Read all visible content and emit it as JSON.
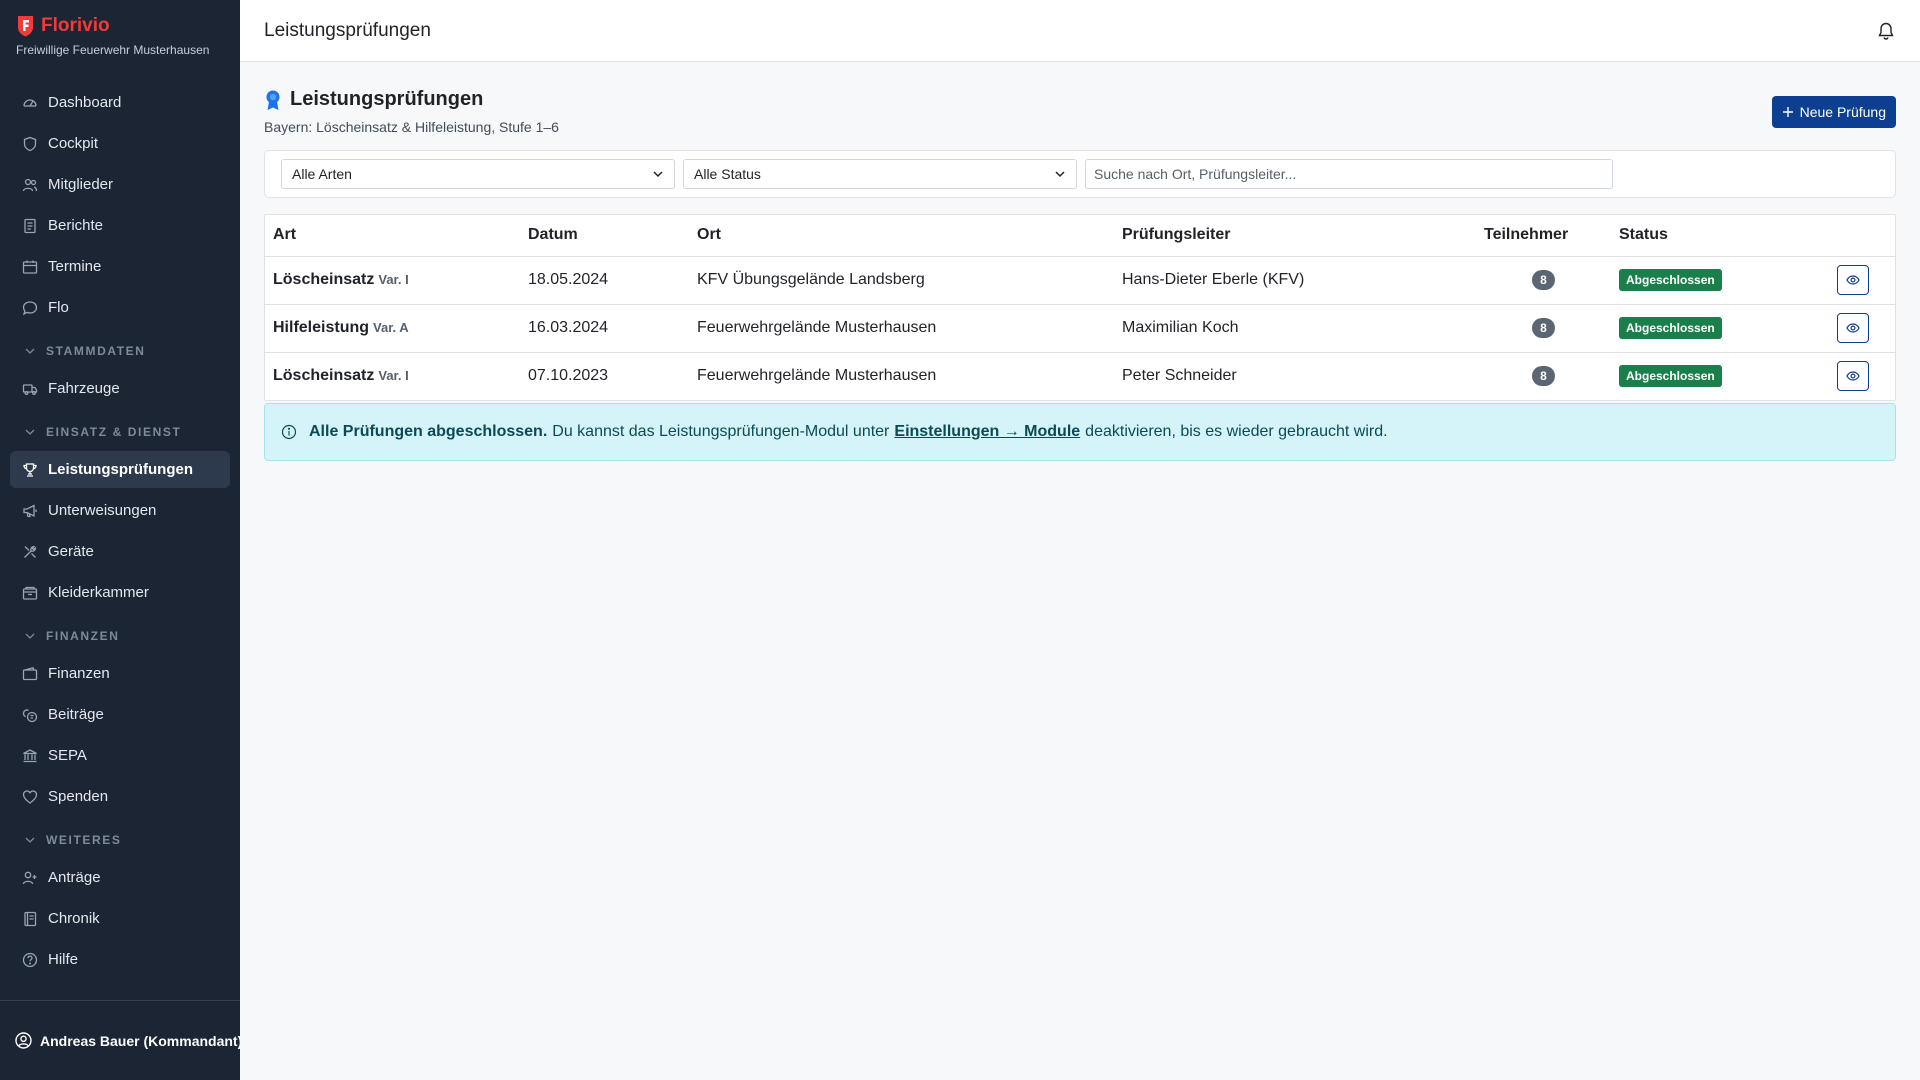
{
  "brand": {
    "name": "Florivio",
    "org": "Freiwillige Feuerwehr Musterhausen"
  },
  "sidebar": {
    "items_top": [
      {
        "label": "Dashboard",
        "icon": "gauge-icon"
      },
      {
        "label": "Cockpit",
        "icon": "shield-icon"
      },
      {
        "label": "Mitglieder",
        "icon": "users-icon"
      },
      {
        "label": "Berichte",
        "icon": "document-icon"
      },
      {
        "label": "Termine",
        "icon": "calendar-icon"
      },
      {
        "label": "Flo",
        "icon": "chat-icon"
      }
    ],
    "sec_stammdaten": "STAMMDATEN",
    "items_stammdaten": [
      {
        "label": "Fahrzeuge",
        "icon": "truck-icon"
      }
    ],
    "sec_einsatz": "EINSATZ & DIENST",
    "items_einsatz": [
      {
        "label": "Leistungsprüfungen",
        "icon": "trophy-icon",
        "active": true
      },
      {
        "label": "Unterweisungen",
        "icon": "megaphone-icon"
      },
      {
        "label": "Geräte",
        "icon": "tools-icon"
      },
      {
        "label": "Kleiderkammer",
        "icon": "box-icon"
      }
    ],
    "sec_finanzen": "FINANZEN",
    "items_finanzen": [
      {
        "label": "Finanzen",
        "icon": "wallet-icon"
      },
      {
        "label": "Beiträge",
        "icon": "coins-icon"
      },
      {
        "label": "SEPA",
        "icon": "bank-icon"
      },
      {
        "label": "Spenden",
        "icon": "heart-icon"
      }
    ],
    "sec_weiteres": "WEITERES",
    "items_weiteres": [
      {
        "label": "Anträge",
        "icon": "user-plus-icon"
      },
      {
        "label": "Chronik",
        "icon": "journal-icon"
      },
      {
        "label": "Hilfe",
        "icon": "question-icon"
      }
    ],
    "user": "Andreas Bauer (Kommandant)"
  },
  "topbar": {
    "title": "Leistungsprüfungen"
  },
  "page": {
    "title": "Leistungsprüfungen",
    "subtitle": "Bayern: Löscheinsatz & Hilfeleistung, Stufe 1–6",
    "new_button": "Neue Prüfung"
  },
  "filters": {
    "art": "Alle Arten",
    "status": "Alle Status",
    "search_placeholder": "Suche nach Ort, Prüfungsleiter..."
  },
  "table": {
    "headers": {
      "art": "Art",
      "datum": "Datum",
      "ort": "Ort",
      "leiter": "Prüfungsleiter",
      "teilnehmer": "Teilnehmer",
      "status": "Status"
    },
    "rows": [
      {
        "art": "Löscheinsatz",
        "var": "Var. I",
        "datum": "18.05.2024",
        "ort": "KFV Übungsgelände Landsberg",
        "leiter": "Hans-Dieter Eberle (KFV)",
        "teilnehmer": "8",
        "status": "Abgeschlossen"
      },
      {
        "art": "Hilfeleistung",
        "var": "Var. A",
        "datum": "16.03.2024",
        "ort": "Feuerwehrgelände Musterhausen",
        "leiter": "Maximilian Koch",
        "teilnehmer": "8",
        "status": "Abgeschlossen"
      },
      {
        "art": "Löscheinsatz",
        "var": "Var. I",
        "datum": "07.10.2023",
        "ort": "Feuerwehrgelände Musterhausen",
        "leiter": "Peter Schneider",
        "teilnehmer": "8",
        "status": "Abgeschlossen"
      }
    ]
  },
  "alert": {
    "strong": "Alle Prüfungen abgeschlossen.",
    "text_before": "Du kannst das Leistungsprüfungen-Modul unter",
    "link": "Einstellungen → Module",
    "text_after": "deaktivieren, bis es wieder gebraucht wird."
  },
  "colors": {
    "sidebar_bg": "#1b2533",
    "brand_red": "#ef3b3b",
    "primary": "#0d3f91",
    "success": "#1a7f4b",
    "info_bg": "#d4f4fa"
  }
}
